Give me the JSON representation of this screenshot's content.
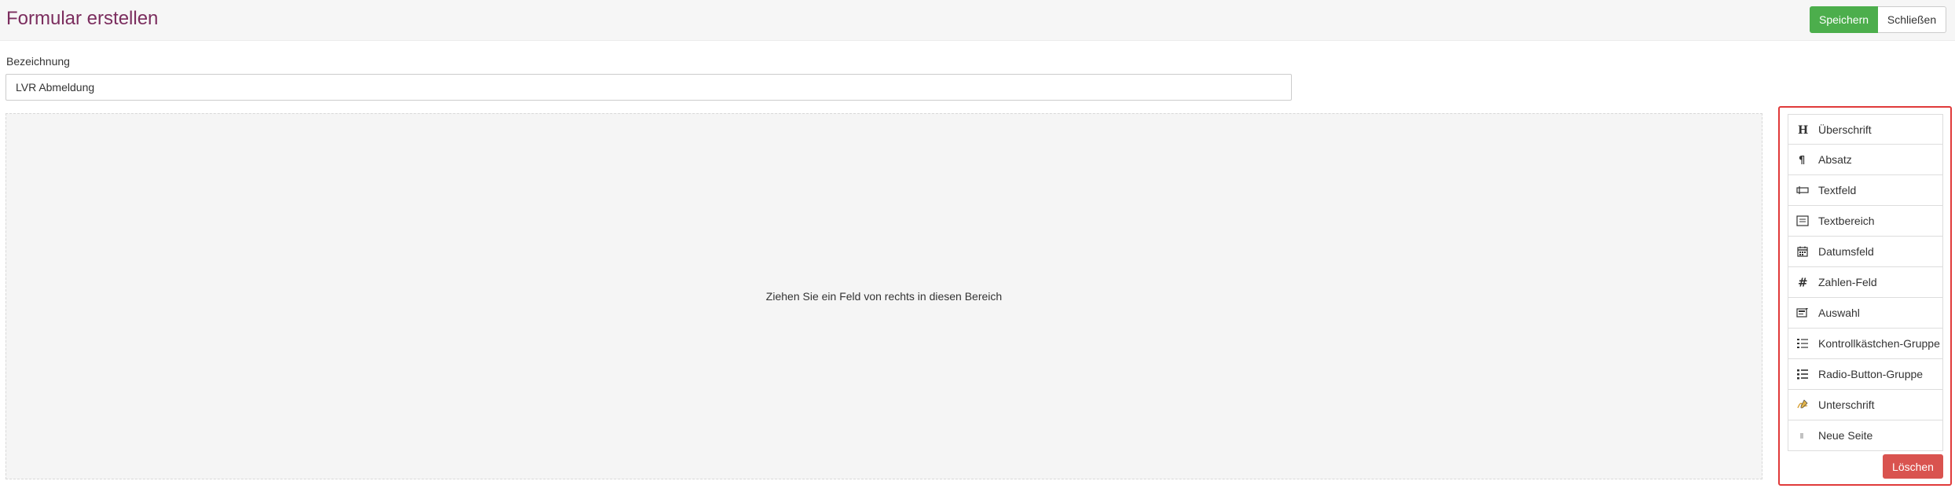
{
  "header": {
    "title": "Formular erstellen",
    "save_label": "Speichern",
    "close_label": "Schließen"
  },
  "form": {
    "name_label": "Bezeichnung",
    "name_value": "LVR Abmeldung"
  },
  "dropzone": {
    "hint": "Ziehen Sie ein Feld von rechts in diesen Bereich"
  },
  "palette": {
    "items": [
      {
        "label": "Überschrift",
        "icon": "heading-icon"
      },
      {
        "label": "Absatz",
        "icon": "paragraph-icon"
      },
      {
        "label": "Textfeld",
        "icon": "textfield-icon"
      },
      {
        "label": "Textbereich",
        "icon": "textarea-icon"
      },
      {
        "label": "Datumsfeld",
        "icon": "calendar-icon"
      },
      {
        "label": "Zahlen-Feld",
        "icon": "hash-icon"
      },
      {
        "label": "Auswahl",
        "icon": "select-icon"
      },
      {
        "label": "Kontrollkästchen-Gruppe",
        "icon": "checkbox-list-icon"
      },
      {
        "label": "Radio-Button-Gruppe",
        "icon": "radio-list-icon"
      },
      {
        "label": "Unterschrift",
        "icon": "signature-icon"
      },
      {
        "label": "Neue Seite",
        "icon": "page-break-icon"
      }
    ],
    "delete_label": "Löschen"
  }
}
